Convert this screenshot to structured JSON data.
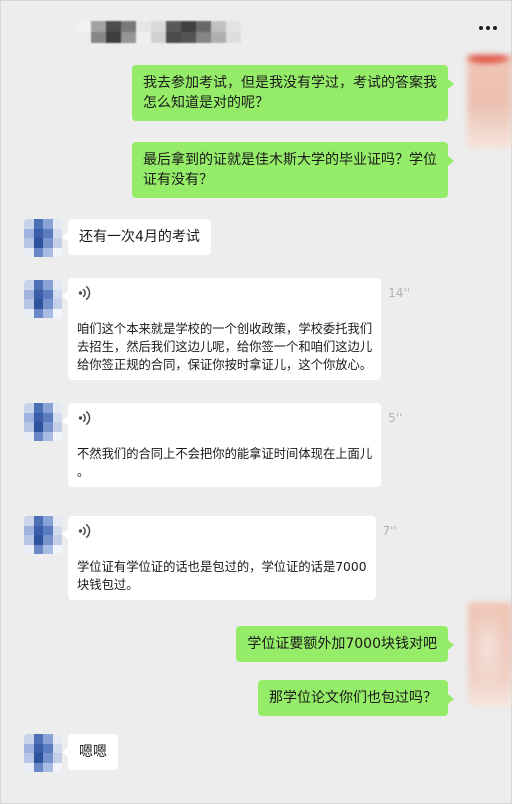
{
  "theme": {
    "background": "#ededed",
    "sent_bubble": "#95ec69",
    "received_bubble": "#ffffff",
    "duration_text": "#b2b2b2"
  },
  "header": {
    "more_icon": "more-icon",
    "title_mosaic": [
      "#f2f2f2",
      "#9a9a9a",
      "#3c3c3c",
      "#6e6e6e",
      "#e6e6e6",
      "#d8d8d8",
      "#4a4a4a",
      "#2e2e2e",
      "#5a5a5a",
      "#bdbdbd",
      "#e3e3e3",
      "#ededed",
      "#7d7d7d",
      "#2a2a2a",
      "#8c8c8c",
      "#f0f0f0",
      "#cfcfcf",
      "#3a3a3a",
      "#444444",
      "#7a7a7a",
      "#a9a9a9",
      "#dcdcdc"
    ]
  },
  "contact_avatar": {
    "mosaic": [
      "#c9d4ea",
      "#4c6fb5",
      "#8aa3d6",
      "#e4e9f4",
      "#9fb3de",
      "#3a5ea8",
      "#5b7cc0",
      "#d3dcef",
      "#b7c6e6",
      "#2f529e",
      "#7792cc",
      "#c4d0ea",
      "#e8edf6",
      "#6a87c7",
      "#a8bbe2",
      "#f1f4fa"
    ]
  },
  "self_avatar": {
    "colors": [
      "#f0c6b7",
      "#ebc0b1",
      "#f6e4dd"
    ],
    "accent": "#df4e3e"
  },
  "messages": [
    {
      "lines": [
        "我去参加考试，但是我没有学过，考试的答案我",
        "怎么知道是对的呢？"
      ]
    },
    {
      "lines": [
        "最后拿到的证就是佳木斯大学的毕业证吗？学位",
        "证有没有？"
      ]
    },
    {
      "lines": [
        "还有一次4月的考试"
      ]
    },
    {
      "voice_icon": "voice-icon",
      "duration": "14''",
      "transcript_lines": [
        "咱们这个本来就是学校的一个创收政策，学校委托我们",
        "去招生，然后我们这边儿呢，给你签一个和咱们这边儿",
        "给你签正规的合同，保证你按时拿证儿，这个你放心。"
      ]
    },
    {
      "voice_icon": "voice-icon",
      "duration": "5''",
      "transcript_lines": [
        "不然我们的合同上不会把你的能拿证时间体现在上面儿",
        "。"
      ]
    },
    {
      "voice_icon": "voice-icon",
      "duration": "7''",
      "transcript_lines": [
        "学位证有学位证的话也是包过的，学位证的话是7000",
        "块钱包过。"
      ]
    },
    {
      "lines": [
        "学位证要额外加7000块钱对吧"
      ]
    },
    {
      "lines": [
        "那学位论文你们也包过吗？"
      ]
    },
    {
      "lines": [
        "嗯嗯"
      ]
    }
  ]
}
